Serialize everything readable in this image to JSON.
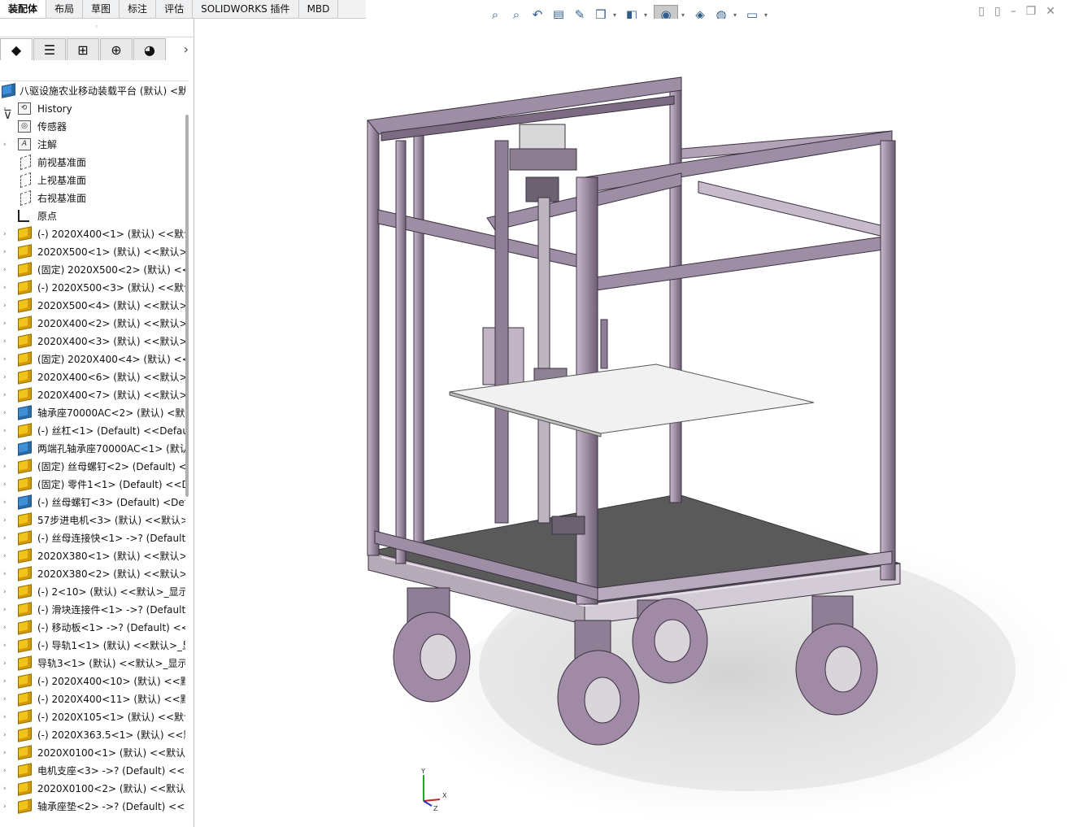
{
  "command_tabs": [
    "装配体",
    "布局",
    "草图",
    "标注",
    "评估",
    "SOLIDWORKS 插件",
    "MBD"
  ],
  "active_tab_index": 0,
  "hud_icons": [
    "zoom-to-fit-icon",
    "zoom-area-icon",
    "previous-view-icon",
    "section-view-icon",
    "dynamic-annotation-icon",
    "view-orientation-icon",
    "display-style-icon",
    "hide-show-items-icon",
    "edit-appearance-icon",
    "apply-scene-icon",
    "view-settings-icon"
  ],
  "panel_tabs": [
    "featuremanager-icon",
    "propertymanager-icon",
    "configurationmanager-icon",
    "dimxpert-icon",
    "display-manager-icon"
  ],
  "tree": {
    "root": "八驱设施农业移动装载平台 (默认) <默",
    "items": [
      {
        "label": "History",
        "icon": "history",
        "expand": true
      },
      {
        "label": "传感器",
        "icon": "sensor",
        "expand": false
      },
      {
        "label": "注解",
        "icon": "annotation",
        "expand": true
      },
      {
        "label": "前视基准面",
        "icon": "plane",
        "expand": false
      },
      {
        "label": "上视基准面",
        "icon": "plane",
        "expand": false
      },
      {
        "label": "右视基准面",
        "icon": "plane",
        "expand": false
      },
      {
        "label": "原点",
        "icon": "origin",
        "expand": false
      },
      {
        "label": "(-) 2020X400<1> (默认) <<默认",
        "icon": "part",
        "expand": true
      },
      {
        "label": "2020X500<1> (默认) <<默认>_",
        "icon": "part",
        "expand": true
      },
      {
        "label": "(固定) 2020X500<2> (默认) <<",
        "icon": "part",
        "expand": true
      },
      {
        "label": "(-) 2020X500<3> (默认) <<默认",
        "icon": "part",
        "expand": true
      },
      {
        "label": "2020X500<4> (默认) <<默认>_",
        "icon": "part",
        "expand": true
      },
      {
        "label": "2020X400<2> (默认) <<默认>_",
        "icon": "part",
        "expand": true
      },
      {
        "label": "2020X400<3> (默认) <<默认>_",
        "icon": "part",
        "expand": true
      },
      {
        "label": "(固定) 2020X400<4> (默认) <<",
        "icon": "part",
        "expand": true
      },
      {
        "label": "2020X400<6> (默认) <<默认>_",
        "icon": "part",
        "expand": true
      },
      {
        "label": "2020X400<7> (默认) <<默认>_",
        "icon": "part",
        "expand": true
      },
      {
        "label": "轴承座70000AC<2> (默认) <默",
        "icon": "asm",
        "expand": true
      },
      {
        "label": "(-) 丝杠<1> (Default) <<Defau",
        "icon": "part",
        "expand": true
      },
      {
        "label": "两端孔轴承座70000AC<1> (默认",
        "icon": "asm",
        "expand": true
      },
      {
        "label": "(固定) 丝母螺钉<2> (Default) <",
        "icon": "part",
        "expand": true
      },
      {
        "label": "(固定) 零件1<1> (Default) <<D",
        "icon": "part",
        "expand": true
      },
      {
        "label": "(-) 丝母螺钉<3> (Default) <Def",
        "icon": "asm",
        "expand": true
      },
      {
        "label": "57步进电机<3> (默认) <<默认>",
        "icon": "part",
        "expand": true
      },
      {
        "label": "(-) 丝母连接快<1> ->? (Default",
        "icon": "part",
        "expand": true
      },
      {
        "label": "2020X380<1> (默认) <<默认>_",
        "icon": "part",
        "expand": true
      },
      {
        "label": "2020X380<2> (默认) <<默认>_",
        "icon": "part",
        "expand": true
      },
      {
        "label": "(-) 2<10> (默认) <<默认>_显示",
        "icon": "part",
        "expand": true
      },
      {
        "label": "(-) 滑块连接件<1> ->? (Default",
        "icon": "part",
        "expand": true
      },
      {
        "label": "(-) 移动板<1> ->? (Default) <<",
        "icon": "part",
        "expand": true
      },
      {
        "label": "(-) 导轨1<1> (默认) <<默认>_显",
        "icon": "part",
        "expand": true
      },
      {
        "label": "导轨3<1> (默认) <<默认>_显示",
        "icon": "part",
        "expand": true
      },
      {
        "label": "(-) 2020X400<10> (默认) <<默",
        "icon": "part",
        "expand": true
      },
      {
        "label": "(-) 2020X400<11> (默认) <<默",
        "icon": "part",
        "expand": true
      },
      {
        "label": "(-) 2020X105<1> (默认) <<默认",
        "icon": "part",
        "expand": true
      },
      {
        "label": "(-) 2020X363.5<1> (默认) <<默",
        "icon": "part",
        "expand": true
      },
      {
        "label": "2020X0100<1> (默认) <<默认>",
        "icon": "part",
        "expand": true
      },
      {
        "label": "电机支座<3> ->? (Default) <<",
        "icon": "part",
        "expand": true
      },
      {
        "label": "2020X0100<2> (默认) <<默认>",
        "icon": "part",
        "expand": true
      },
      {
        "label": "轴承座垫<2> ->? (Default) <<",
        "icon": "part",
        "expand": true
      }
    ]
  },
  "triad": {
    "x_label": "X",
    "y_label": "Y",
    "z_label": "Z"
  },
  "colors": {
    "frame": "#8f7f96",
    "frame_dark": "#5e5166",
    "plate": "#ececec",
    "wheel": "#a08aa6",
    "accent": "#2f5d8c"
  }
}
